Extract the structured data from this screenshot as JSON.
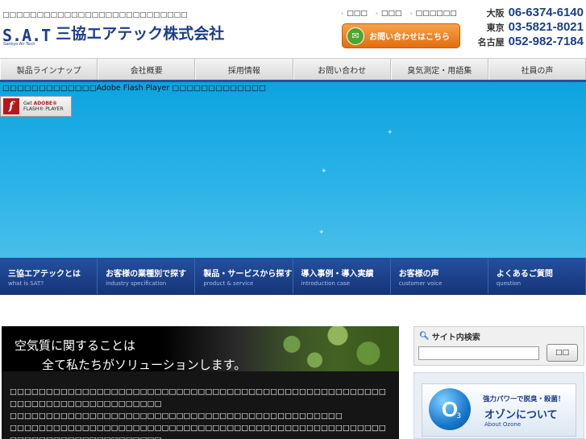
{
  "header": {
    "tagline": "□□□□□□□□□□□□□□□□□□□□□□□□□□□",
    "logo_mark": "S.A.T",
    "logo_sub": "Sankyo Air Tech",
    "company_name": "三協エアテック株式会社",
    "top_links": [
      "□□□",
      "□□□",
      "□□□□□□"
    ],
    "contact_button": "お問い合わせはこちら",
    "phones": [
      {
        "city": "大阪",
        "number": "06-6374-6140"
      },
      {
        "city": "東京",
        "number": "03-5821-8021"
      },
      {
        "city": "名古屋",
        "number": "052-982-7184"
      }
    ]
  },
  "gnav": [
    "製品ラインナップ",
    "会社概要",
    "採用情報",
    "お問い合わせ",
    "臭気測定・用語集",
    "社員の声"
  ],
  "flash": {
    "message": "□□□□□□□□□□□□□Adobe Flash Player □□□□□□□□□□□□□",
    "badge_get": "Get",
    "badge_adobe": "ADOBE®",
    "badge_flash": "FLASH® PLAYER"
  },
  "subnav": [
    {
      "jp": "三協エアテックとは",
      "en": "what is SAT?"
    },
    {
      "jp": "お客様の業種別で探す",
      "en": "industry specification"
    },
    {
      "jp": "製品・サービスから探す",
      "en": "product & service"
    },
    {
      "jp": "導入事例・導入実績",
      "en": "introduction case"
    },
    {
      "jp": "お客様の声",
      "en": "customer voice"
    },
    {
      "jp": "よくあるご質問",
      "en": "question"
    }
  ],
  "hero": {
    "line1": "空気質に関することは",
    "line2": "全て私たちがソリューションします。",
    "body": [
      "□□□□□□□□□□□□□□□□□□□□□□□□□□□□□□□□□□□□□□□□□□□□□□□□□□□□□□□□□□□□□□□□□□□□□□□□□",
      "□□□□□□□□□□□□□□□□□□□□□□□□□□□□□□□□□□□□□□□□□□□□□□",
      "□□□□□□□□□□□□□□□□□□□□□□□□□□□□□□□□□□□□□□□□□□□□□□□□□□□□□□□□□□□□□□□□□□□□□□□□□",
      "□□□□□□□□□□□□□□□□□□□□□□□□□□□□□□□□□□□□□□□□□□□□□"
    ]
  },
  "sidebar": {
    "search_title": "サイト内検索",
    "search_value": "",
    "search_button": "□□",
    "banner_line1": "強力パワーで脱臭・殺菌！",
    "banner_line2": "オゾンについて",
    "banner_line3": "About Ozone",
    "banner_o3": "O",
    "banner_o3_sub": "3"
  },
  "colors": {
    "brand_blue": "#1c3f88",
    "flash_bg": "#2ab2e7",
    "subnav_bg": "#1e4690",
    "contact_orange": "#f08a2a"
  }
}
